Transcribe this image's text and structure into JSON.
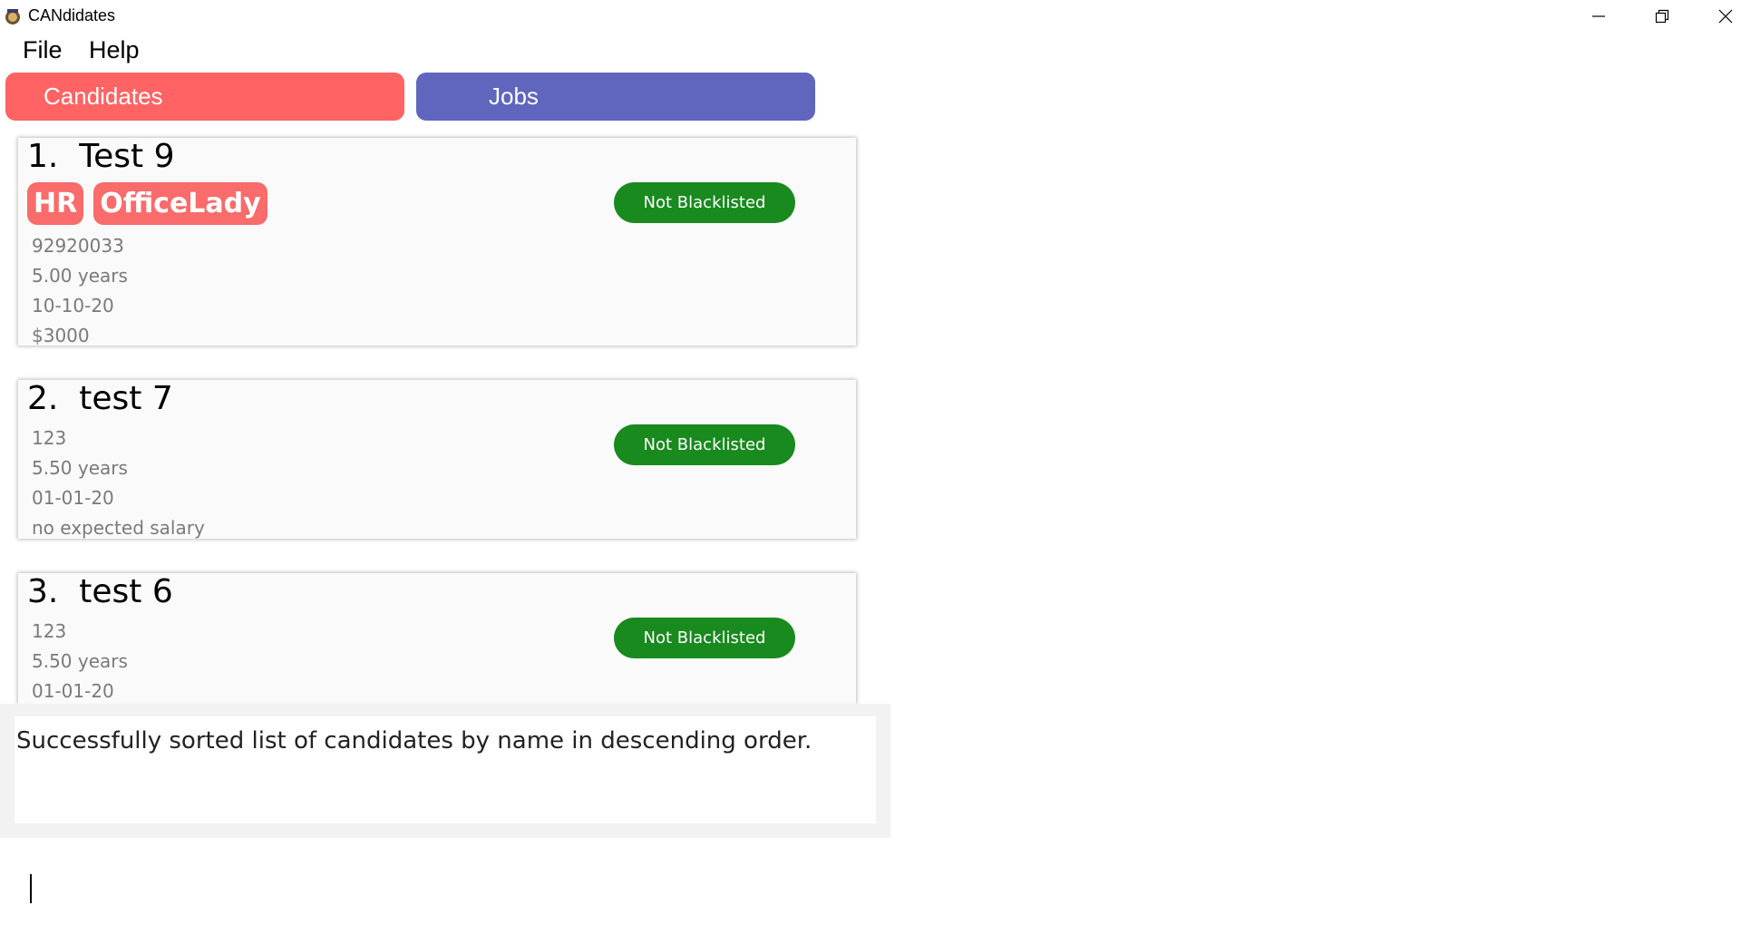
{
  "window": {
    "title": "CANdidates",
    "icons": {
      "app": "candidates-app-icon",
      "minimize": "minimize-icon",
      "restore": "restore-icon",
      "close": "close-icon"
    }
  },
  "menu": {
    "file": "File",
    "help": "Help"
  },
  "tabs": {
    "candidates": {
      "label": "Candidates",
      "color": "#ff6363"
    },
    "jobs": {
      "label": "Jobs",
      "color": "#6065be"
    }
  },
  "candidates": [
    {
      "index": "1.",
      "name": "Test 9",
      "tags": [
        "HR",
        "OfficeLady"
      ],
      "phone": "92920033",
      "experience": "5.00 years",
      "date": "10-10-20",
      "salary": "$3000",
      "status": "Not Blacklisted"
    },
    {
      "index": "2.",
      "name": "test 7",
      "tags": [],
      "phone": "123",
      "experience": "5.50 years",
      "date": "01-01-20",
      "salary": "no expected salary",
      "status": "Not Blacklisted"
    },
    {
      "index": "3.",
      "name": "test 6",
      "tags": [],
      "phone": "123",
      "experience": "5.50 years",
      "date": "01-01-20",
      "salary": "",
      "status": "Not Blacklisted"
    }
  ],
  "colors": {
    "tag": "#fa6b6b",
    "status_badge": "#188a1e"
  },
  "result": {
    "message": "Successfully sorted list of candidates by name in descending order."
  },
  "command": {
    "value": ""
  }
}
